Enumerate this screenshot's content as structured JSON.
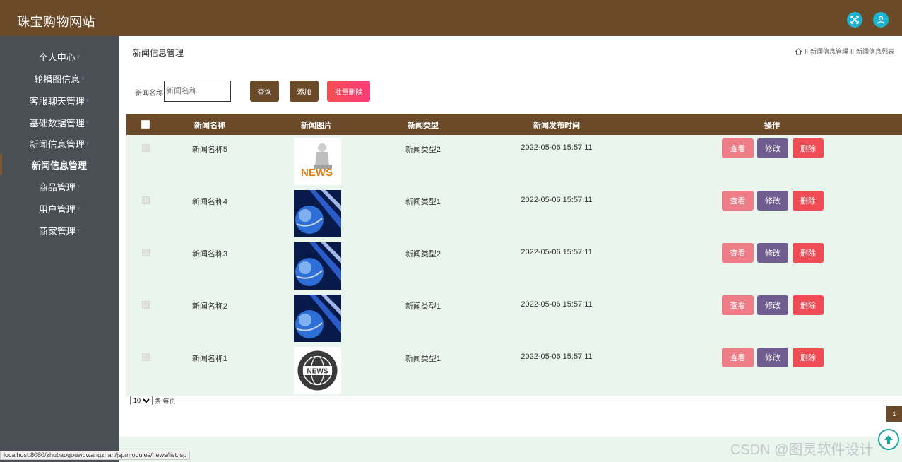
{
  "header": {
    "site_title": "珠宝购物网站",
    "icons": [
      "fullscreen-icon",
      "user-icon"
    ],
    "accent": "#6b4a2a",
    "icon_color": "#1bb5d1"
  },
  "sidebar": {
    "items": [
      {
        "label": "个人中心"
      },
      {
        "label": "轮播图信息"
      },
      {
        "label": "客服聊天管理"
      },
      {
        "label": "基础数据管理"
      },
      {
        "label": "新闻信息管理"
      },
      {
        "label": "新闻信息管理"
      },
      {
        "label": "商品管理"
      },
      {
        "label": "用户管理"
      },
      {
        "label": "商家管理"
      }
    ],
    "active_index": 5
  },
  "page": {
    "heading": "新闻信息管理",
    "breadcrumb": [
      "新闻信息管理",
      "新闻信息列表"
    ],
    "breadcrumb_sep": "II"
  },
  "search": {
    "label": "新闻名称",
    "placeholder": "新闻名称",
    "query_label": "查询",
    "add_label": "添加",
    "batch_delete_label": "批量删除"
  },
  "table": {
    "columns": [
      "新闻名称",
      "新闻图片",
      "新闻类型",
      "新闻发布时间",
      "操作"
    ],
    "rows": [
      {
        "name": "新闻名称5",
        "image": "news-figure",
        "type": "新闻类型2",
        "time": "2022-05-06 15:57:11"
      },
      {
        "name": "新闻名称4",
        "image": "globe",
        "type": "新闻类型1",
        "time": "2022-05-06 15:57:11"
      },
      {
        "name": "新闻名称3",
        "image": "globe",
        "type": "新闻类型2",
        "time": "2022-05-06 15:57:11"
      },
      {
        "name": "新闻名称2",
        "image": "globe",
        "type": "新闻类型1",
        "time": "2022-05-06 15:57:11"
      },
      {
        "name": "新闻名称1",
        "image": "news-badge",
        "type": "新闻类型1",
        "time": "2022-05-06 15:57:11"
      }
    ],
    "actions": {
      "view": "查看",
      "edit": "修改",
      "delete": "删除"
    },
    "colors": {
      "view": "#ef7d88",
      "edit": "#6e5d8e",
      "delete": "#f04c56",
      "row_bg": "#eaf5ee"
    }
  },
  "pagination": {
    "page_size": "10",
    "page_size_suffix": "条 每页",
    "current_page": "1"
  },
  "status_url": "localhost:8080/zhubaogouwuwangzhan/jsp/modules/news/list.jsp",
  "watermark": "CSDN @图灵软件设计"
}
